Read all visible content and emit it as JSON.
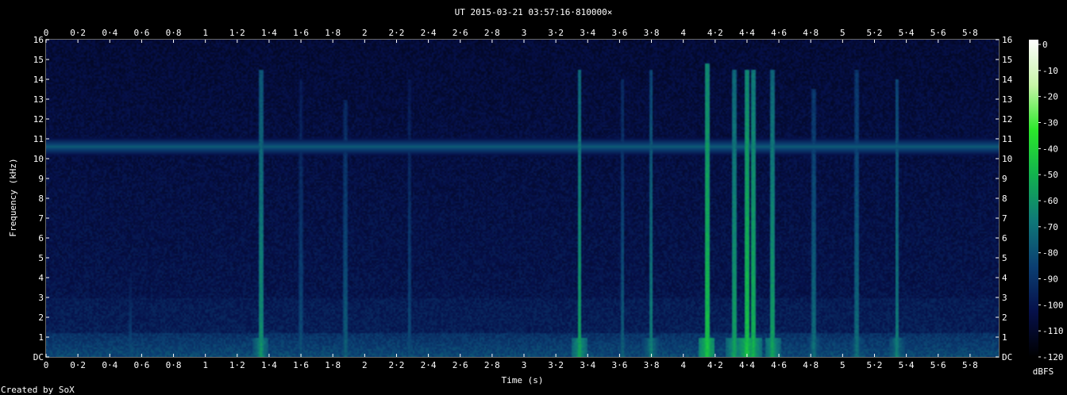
{
  "chart_data": {
    "type": "heatmap",
    "title": "UT 2015-03-21 03:57:16·810000×",
    "xlabel": "Time (s)",
    "ylabel": "Frequency (kHz)",
    "xlim": [
      0,
      5.98
    ],
    "ylim": [
      0,
      16
    ],
    "x_tick_labels": [
      "0",
      "0·2",
      "0·4",
      "0·6",
      "0·8",
      "1",
      "1·2",
      "1·4",
      "1·6",
      "1·8",
      "2",
      "2·2",
      "2·4",
      "2·6",
      "2·8",
      "3",
      "3·2",
      "3·4",
      "3·6",
      "3·8",
      "4",
      "4·2",
      "4·4",
      "4·6",
      "4·8",
      "5",
      "5·2",
      "5·4",
      "5·6",
      "5·8"
    ],
    "y_tick_labels": [
      "DC",
      "1",
      "2",
      "3",
      "4",
      "5",
      "6",
      "7",
      "8",
      "9",
      "10",
      "11",
      "12",
      "13",
      "14",
      "15",
      "16"
    ],
    "colorbar": {
      "label": "dBFS",
      "tick_labels": [
        "0",
        "-10",
        "-20",
        "-30",
        "-40",
        "-50",
        "-60",
        "-70",
        "-80",
        "-90",
        "-100",
        "-110",
        "-120"
      ],
      "range": [
        -120,
        0
      ],
      "colors": [
        "#000000",
        "#06104a",
        "#0b3f72",
        "#0f7878",
        "#12b14f",
        "#2be82b",
        "#c8f5a8",
        "#ffffff"
      ]
    },
    "features": {
      "background_dbfs": -100,
      "steady_tone_khz": 10.6,
      "low_frequency_band_khz": [
        0,
        1.2
      ],
      "bursts": [
        {
          "t": 0.53,
          "f_max": 4,
          "level": -80
        },
        {
          "t": 1.35,
          "f_max": 14.5,
          "level": -60
        },
        {
          "t": 1.6,
          "f_max": 14,
          "level": -80
        },
        {
          "t": 1.88,
          "f_max": 13,
          "level": -75
        },
        {
          "t": 2.28,
          "f_max": 14,
          "level": -80
        },
        {
          "t": 3.35,
          "f_max": 14.5,
          "level": -55
        },
        {
          "t": 3.62,
          "f_max": 14,
          "level": -75
        },
        {
          "t": 3.8,
          "f_max": 14.5,
          "level": -65
        },
        {
          "t": 4.15,
          "f_max": 14.8,
          "level": -45
        },
        {
          "t": 4.32,
          "f_max": 14.5,
          "level": -55
        },
        {
          "t": 4.4,
          "f_max": 14.5,
          "level": -45
        },
        {
          "t": 4.44,
          "f_max": 14.5,
          "level": -50
        },
        {
          "t": 4.56,
          "f_max": 14.5,
          "level": -55
        },
        {
          "t": 4.82,
          "f_max": 13.5,
          "level": -70
        },
        {
          "t": 5.09,
          "f_max": 14.5,
          "level": -70
        },
        {
          "t": 5.34,
          "f_max": 14,
          "level": -65
        }
      ]
    }
  },
  "footer": {
    "credit": "Created by SoX"
  }
}
